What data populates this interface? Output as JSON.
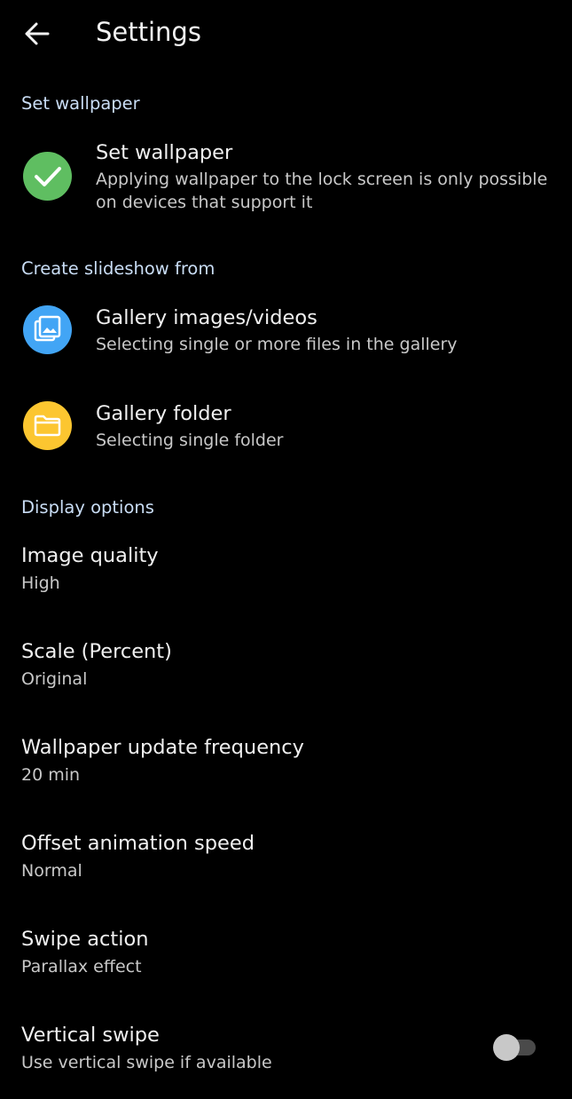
{
  "header": {
    "title": "Settings",
    "back_icon": "arrow-left-icon"
  },
  "sections": {
    "wallpaper": {
      "header": "Set wallpaper",
      "item": {
        "title": "Set wallpaper",
        "subtitle_line1": "Applying wallpaper to the lock screen is only possible",
        "subtitle_line2": "on devices that support it",
        "icon": "check-icon",
        "icon_color": "#5fbe61"
      }
    },
    "slideshow": {
      "header": "Create slideshow from",
      "gallery": {
        "title": "Gallery images/videos",
        "subtitle": "Selecting single or more files in the gallery",
        "icon": "gallery-icon",
        "icon_color": "#42a5f5"
      },
      "folder": {
        "title": "Gallery folder",
        "subtitle": "Selecting single folder",
        "icon": "folder-icon",
        "icon_color": "#fcc630"
      }
    },
    "display": {
      "header": "Display options",
      "image_quality": {
        "title": "Image quality",
        "value": "High"
      },
      "scale": {
        "title": "Scale (Percent)",
        "value": "Original"
      },
      "update_frequency": {
        "title": "Wallpaper update frequency",
        "value": "20 min"
      },
      "animation_speed": {
        "title": "Offset animation speed",
        "value": "Normal"
      },
      "swipe_action": {
        "title": "Swipe action",
        "value": "Parallax effect"
      },
      "vertical_swipe": {
        "title": "Vertical swipe",
        "value": "Use vertical swipe if available",
        "toggle_on": false
      }
    }
  },
  "colors": {
    "background": "#000000",
    "section_header": "#c9ddf5",
    "primary_text": "#f0f0f0",
    "secondary_text": "#c8c8c8"
  }
}
